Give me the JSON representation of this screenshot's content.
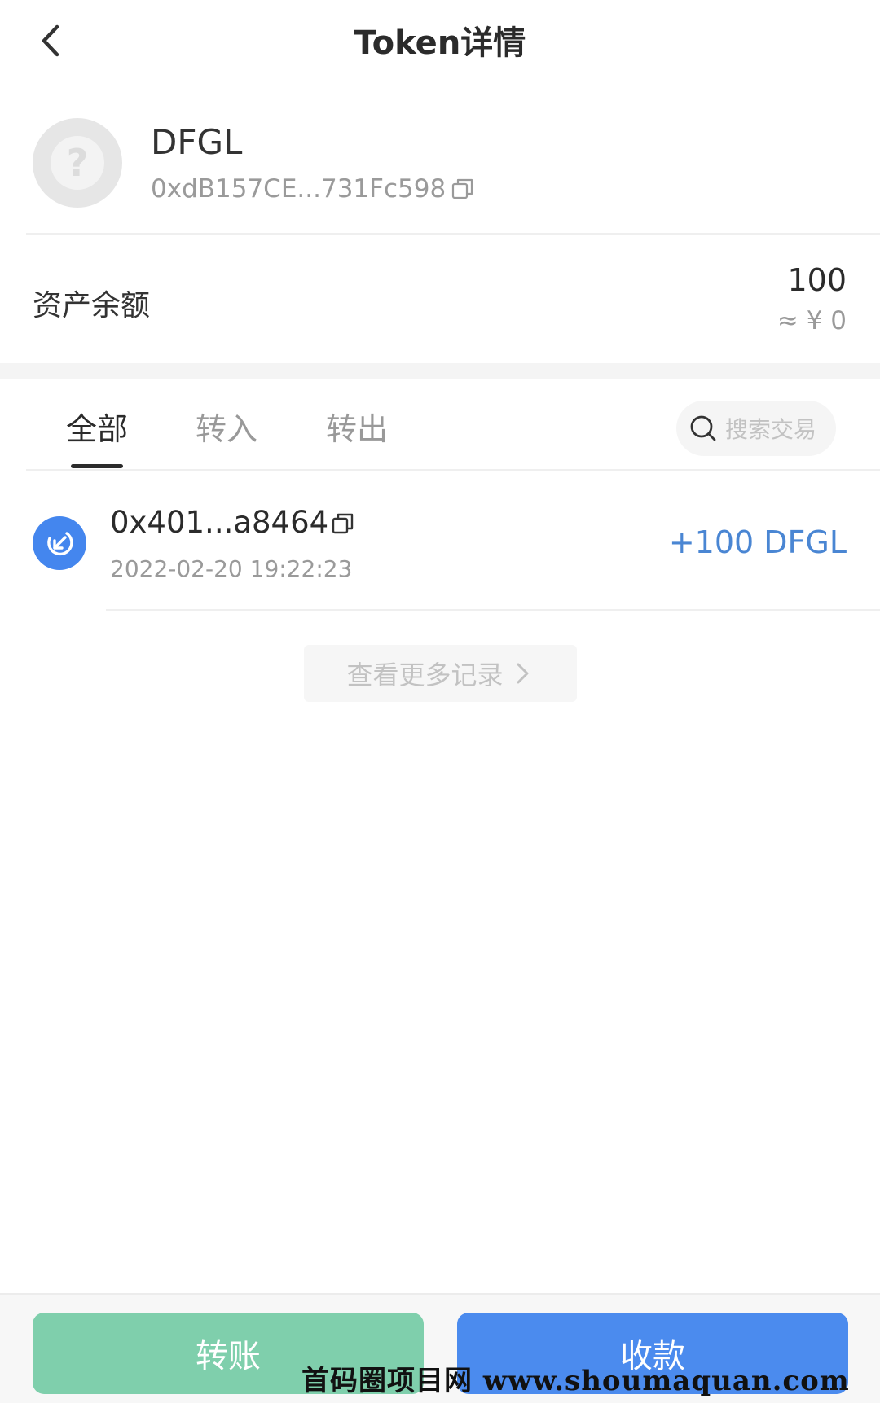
{
  "header": {
    "title": "Token详情"
  },
  "token": {
    "name": "DFGL",
    "address": "0xdB157CE...731Fc598",
    "logo_icon": "question-mark-icon"
  },
  "balance": {
    "label": "资产余额",
    "amount": "100",
    "fiat": "≈ ¥ 0"
  },
  "tabs": [
    {
      "label": "全部",
      "active": true
    },
    {
      "label": "转入",
      "active": false
    },
    {
      "label": "转出",
      "active": false
    }
  ],
  "search": {
    "placeholder": "搜索交易"
  },
  "transactions": [
    {
      "address": "0x401...a8464",
      "time": "2022-02-20 19:22:23",
      "amount": "+100 DFGL",
      "direction_icon": "incoming-arrow-icon"
    }
  ],
  "view_more": {
    "label": "查看更多记录"
  },
  "actions": {
    "transfer_label": "转账",
    "receive_label": "收款"
  },
  "watermark": "首码圈项目网 www.shoumaquan.com",
  "colors": {
    "primary_blue": "#4b8bee",
    "transfer_green": "#7fcfac",
    "amount_blue": "#4a86d3"
  }
}
